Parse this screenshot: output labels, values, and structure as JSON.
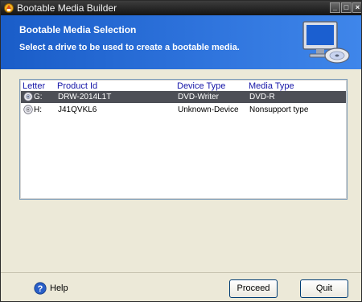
{
  "window": {
    "title": "Bootable Media Builder",
    "controls": {
      "minimize": "_",
      "maximize": "□",
      "close": "×"
    }
  },
  "header": {
    "title": "Bootable Media Selection",
    "subtitle": "Select a drive to be used to create a bootable media.",
    "art_icon": "computer-disc-icon"
  },
  "table": {
    "columns": [
      "Letter",
      "Product Id",
      "Device Type",
      "Media Type"
    ],
    "rows": [
      {
        "icon": "dvd-drive-icon",
        "letter": "G:",
        "product_id": "DRW-2014L1T",
        "device_type": "DVD-Writer",
        "media_type": "DVD-R",
        "selected": true
      },
      {
        "icon": "disc-drive-icon",
        "letter": "H:",
        "product_id": "J41QVKL6",
        "device_type": "Unknown-Device",
        "media_type": "Nonsupport type",
        "selected": false
      }
    ]
  },
  "footer": {
    "help_label": "Help",
    "proceed_label": "Proceed",
    "quit_label": "Quit"
  },
  "colors": {
    "header_blue": "#2e73dc",
    "selected_row": "#4d4f56",
    "column_header_text": "#1515a8"
  }
}
